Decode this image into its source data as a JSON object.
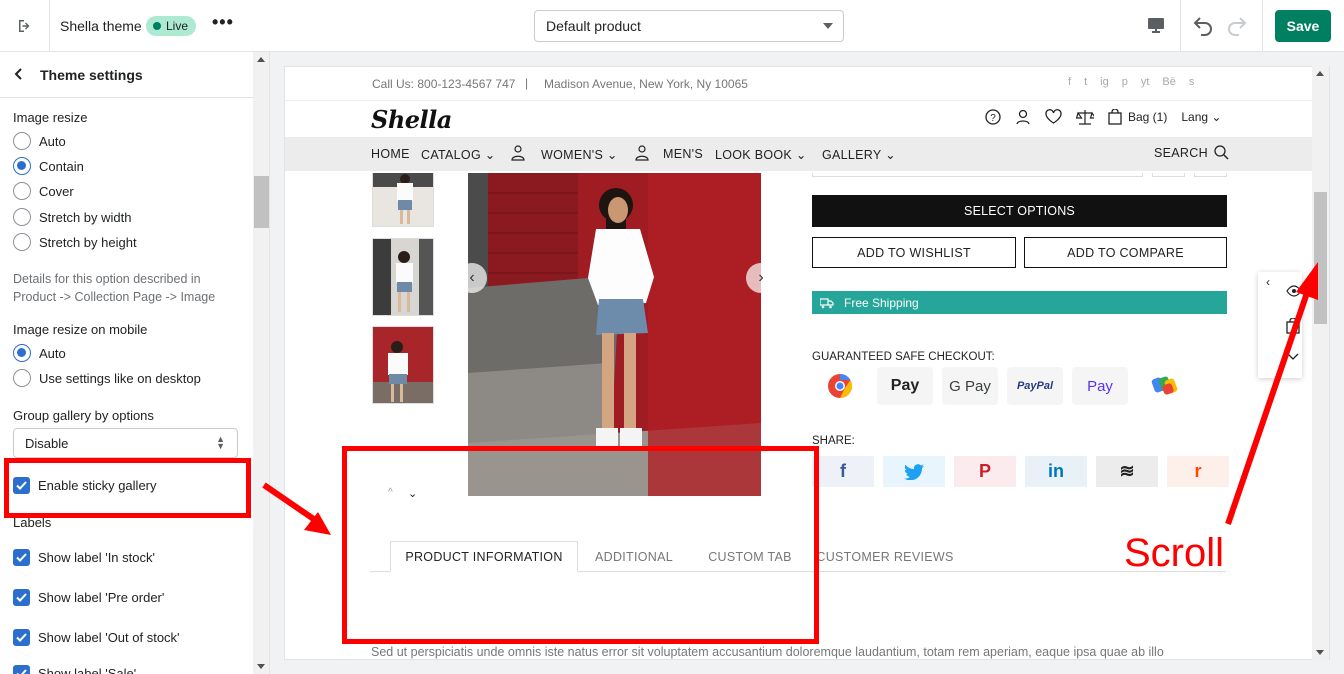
{
  "topbar": {
    "theme_name": "Shella theme",
    "live_badge": "Live",
    "more": "•••",
    "template_select": "Default product",
    "save_label": "Save"
  },
  "sidebar": {
    "title": "Theme settings",
    "image_resize": {
      "label": "Image resize",
      "options": [
        "Auto",
        "Contain",
        "Cover",
        "Stretch by width",
        "Stretch by height"
      ],
      "selected": "Contain"
    },
    "help_text": "Details for this option described in Product -> Collection Page -> Image",
    "image_resize_mobile": {
      "label": "Image resize on mobile",
      "options": [
        "Auto",
        "Use settings like on desktop"
      ],
      "selected": "Auto"
    },
    "group_gallery": {
      "label": "Group gallery by options",
      "value": "Disable"
    },
    "sticky_gallery": "Enable sticky gallery",
    "labels_heading": "Labels",
    "label_checks": [
      "Show label 'In stock'",
      "Show label 'Pre order'",
      "Show label 'Out of stock'",
      "Show label 'Sale'"
    ]
  },
  "preview": {
    "call": "Call Us: 800-123-4567 747",
    "pipe": "|",
    "address": "Madison Avenue, New York, Ny 10065",
    "social": [
      "f",
      "t",
      "ig",
      "p",
      "yt",
      "Bē",
      "s"
    ],
    "logo": "Shella",
    "bag": "Bag (1)",
    "lang": "Lang",
    "nav": {
      "home": "HOME",
      "catalog": "CATALOG",
      "womens": "WOMEN'S",
      "mens": "MEN'S",
      "lookbook": "LOOK BOOK",
      "gallery": "GALLERY",
      "search": "SEARCH"
    },
    "select_options": "SELECT OPTIONS",
    "add_wishlist": "ADD TO WISHLIST",
    "add_compare": "ADD TO COMPARE",
    "free_shipping": "Free Shipping",
    "guaranteed": "GUARANTEED SAFE CHECKOUT:",
    "payments": [
      "Pay",
      "G Pay",
      "PayPal",
      "Pay"
    ],
    "share": "SHARE:",
    "share_icons": [
      "f",
      "t",
      "P",
      "in",
      "≋",
      "r"
    ],
    "tabs": [
      "PRODUCT INFORMATION",
      "ADDITIONAL",
      "CUSTOM TAB",
      "CUSTOMER REVIEWS"
    ],
    "lorem": "Sed ut perspiciatis unde omnis iste natus error sit voluptatem accusantium doloremque laudantium, totam rem aperiam, eaque ipsa quae ab illo"
  },
  "annotation": {
    "scroll_text": "Scroll",
    "color": "#ff0000"
  },
  "colors": {
    "save_green": "#008060",
    "accent_blue": "#2c6ecb",
    "shipping_teal": "#26a69a"
  }
}
